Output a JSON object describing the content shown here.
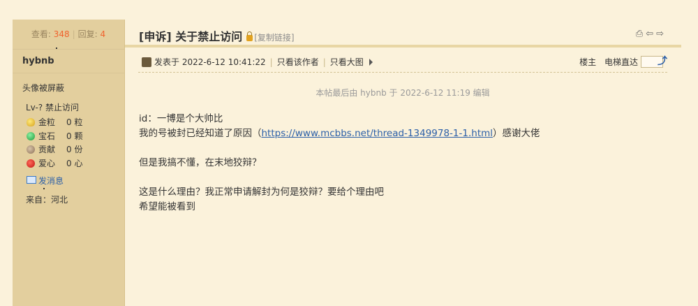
{
  "sidebar": {
    "views_label": "查看:",
    "views": "348",
    "replies_label": "回复:",
    "replies": "4",
    "username": "hybnb",
    "avatar_note": "头像被屏蔽",
    "level": "Lv-? 禁止访问",
    "stats": [
      {
        "label": "金粒",
        "value": "0 粒",
        "icon": "gold-nugget-icon"
      },
      {
        "label": "宝石",
        "value": "0 颗",
        "icon": "emerald-icon"
      },
      {
        "label": "贡献",
        "value": "0 份",
        "icon": "contribution-icon"
      },
      {
        "label": "爱心",
        "value": "0 心",
        "icon": "heart-apple-icon"
      }
    ],
    "pm_label": "发消息",
    "from": "来自：河北"
  },
  "thread": {
    "prefix": "[申诉]",
    "title": "关于禁止访问",
    "copy_link": "[复制链接]",
    "icons": [
      "print-icon",
      "prev-thread-icon",
      "next-thread-icon"
    ]
  },
  "post": {
    "posted_at": "发表于 2022-6-12 10:41:22",
    "only_author": "只看该作者",
    "big_image": "只看大图",
    "floor_label": "楼主",
    "elevator_label": "电梯直达",
    "edit_note": "本帖最后由 hybnb 于 2022-6-12 11:19 编辑",
    "line1": "id：一博是个大帅比",
    "line2_before": "我的号被封已经知道了原因（",
    "link": "https://www.mcbbs.net/thread-1349978-1-1.html",
    "line2_after": "）感谢大佬",
    "line3": "但是我搞不懂，在末地狡辩？",
    "line4": "这是什么理由？我正常申请解封为何是狡辩？要给个理由吧",
    "line5": "希望能被看到"
  },
  "colors": {
    "page_bg": "#fbf2db",
    "sidebar_bg": "#e3cf9e",
    "link": "#2b5fa8",
    "count_highlight": "#f0622d"
  }
}
